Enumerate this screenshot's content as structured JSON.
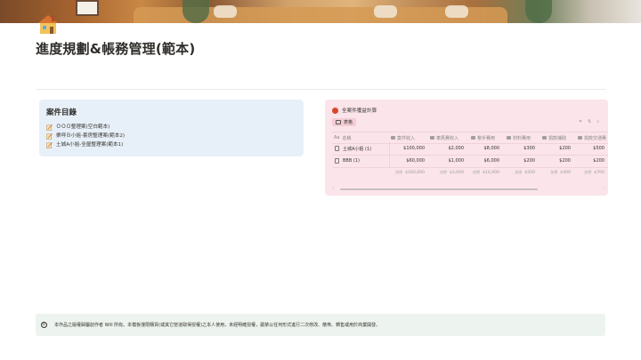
{
  "page": {
    "title": "進度規劃&帳務管理(範本)"
  },
  "case_list": {
    "heading": "案件目錄",
    "items": [
      {
        "label": "ＯＯＯ整理案(空白範本)"
      },
      {
        "label": "樂呼Ｂ小姐-套房整理案(範本2)"
      },
      {
        "label": "土城A小姐-全屋整理案(範本1)"
      }
    ]
  },
  "accounting": {
    "title": "全案件獲益計算",
    "view_tab": "表格",
    "columns": [
      {
        "label": "名稱",
        "icon": "text-aa-icon",
        "prefix": "Aa"
      },
      {
        "label": "案件收入",
        "icon": "revenue-icon"
      },
      {
        "label": "車馬費收入",
        "icon": "car-fee-icon"
      },
      {
        "label": "幫手費用",
        "icon": "helper-icon"
      },
      {
        "label": "材料費用",
        "icon": "material-icon"
      },
      {
        "label": "捐款補助",
        "icon": "subsidy-icon"
      },
      {
        "label": "捐款交通費",
        "icon": "transport-icon"
      }
    ],
    "rows": [
      {
        "name": "土城A小姐 (1)",
        "values": [
          "$100,000",
          "$2,000",
          "$8,000",
          "$300",
          "$200",
          "$500"
        ]
      },
      {
        "name": "BBB (1)",
        "values": [
          "$60,000",
          "$1,000",
          "$6,000",
          "$200",
          "$200",
          "$200"
        ]
      }
    ],
    "sum_label": "加總",
    "sums": [
      "$160,000",
      "$3,000",
      "$14,000",
      "$500",
      "$400",
      "$700"
    ]
  },
  "footer": {
    "notice": "本作品之版權歸屬創作者 Will 所有。本模板僅限購買(或其它管道取得授權)之本人使用，未經明確授權，嚴禁以任何形式進行二次修改、散佈、轉售或用於商業開發。"
  },
  "colors": {
    "callout_blue": "#e7f0f9",
    "callout_pink": "#fbe4ea",
    "footer_bg": "#edf3ee"
  }
}
